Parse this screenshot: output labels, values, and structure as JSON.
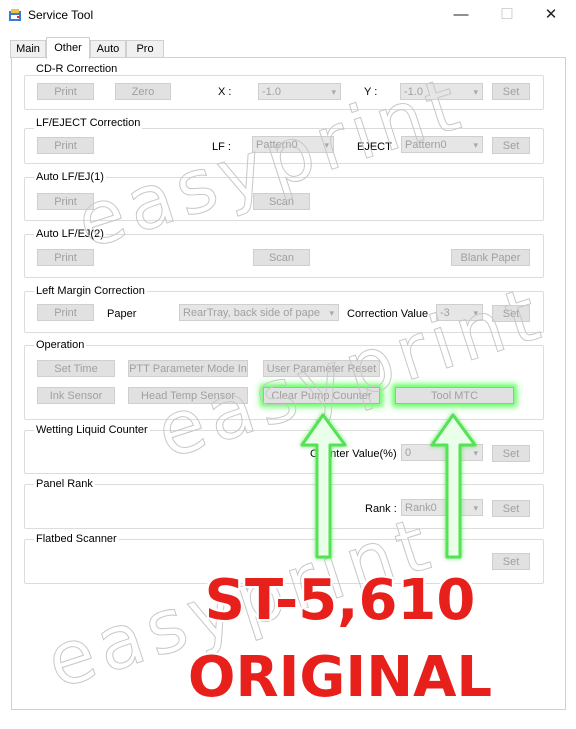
{
  "window": {
    "title": "Service Tool",
    "minimize": "—",
    "maximize": "☐",
    "close": "✕"
  },
  "tabs": [
    {
      "label": "Main"
    },
    {
      "label": "Other"
    },
    {
      "label": "Auto"
    },
    {
      "label": "Pro"
    }
  ],
  "cdr": {
    "title": "CD-R Correction",
    "print": "Print",
    "zero": "Zero",
    "x_label": "X :",
    "x_value": "-1.0",
    "y_label": "Y :",
    "y_value": "-1.0",
    "set": "Set"
  },
  "lfeject": {
    "title": "LF/EJECT Correction",
    "print": "Print",
    "lf_label": "LF :",
    "lf_value": "Pattern0",
    "eject_label": "EJECT",
    "eject_value": "Pattern0",
    "set": "Set"
  },
  "autolf1": {
    "title": "Auto LF/EJ(1)",
    "print": "Print",
    "scan": "Scan"
  },
  "autolf2": {
    "title": "Auto LF/EJ(2)",
    "print": "Print",
    "scan": "Scan",
    "blank": "Blank Paper"
  },
  "leftmargin": {
    "title": "Left Margin Correction",
    "print": "Print",
    "paper_label": "Paper",
    "paper_value": "RearTray, back side of pape",
    "corr_label": "Correction Value",
    "corr_value": "-3",
    "set": "Set"
  },
  "operation": {
    "title": "Operation",
    "set_time": "Set Time",
    "ptt": "PTT Parameter Mode In",
    "user_param": "User Parameter Reset",
    "ink_sensor": "Ink Sensor",
    "head_temp": "Head Temp Sensor",
    "clear_pump": "Clear Pump Counter",
    "tool_mtc": "Tool MTC"
  },
  "wetting": {
    "title": "Wetting Liquid Counter",
    "counter_label": "Counter Value(%)",
    "counter_value": "0",
    "set": "Set"
  },
  "panelrank": {
    "title": "Panel Rank",
    "rank_label": "Rank :",
    "rank_value": "Rank0",
    "set": "Set"
  },
  "flatbed": {
    "title": "Flatbed Scanner",
    "set": "Set"
  },
  "overlay": {
    "watermark": "easyprint",
    "promo_line1": "ST-5,610",
    "promo_line2": "ORIGINAL"
  },
  "colors": {
    "accent_green": "#6cff6c",
    "promo_red": "#e8201c"
  }
}
